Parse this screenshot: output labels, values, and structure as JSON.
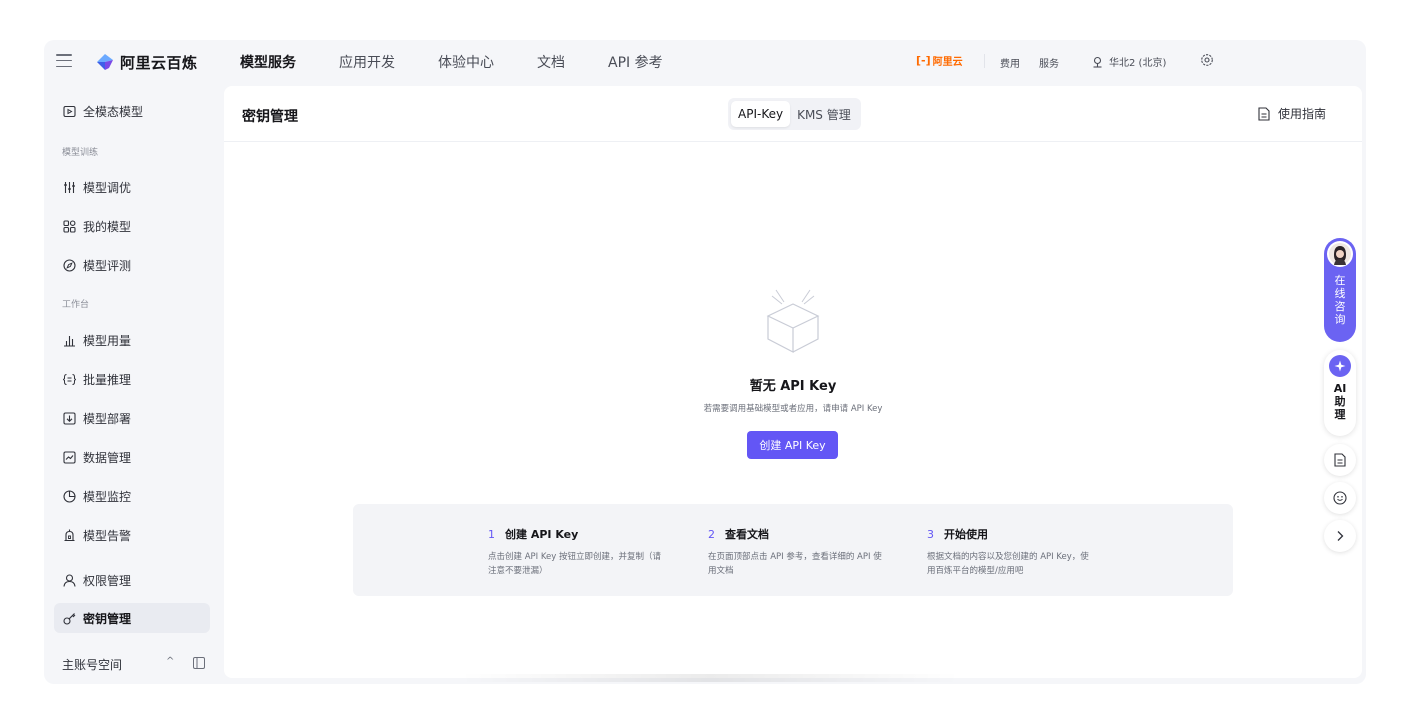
{
  "brand": {
    "name": "阿里云百炼"
  },
  "nav": {
    "items": [
      "模型服务",
      "应用开发",
      "体验中心",
      "文档",
      "API 参考"
    ],
    "active": 0
  },
  "topbar": {
    "aliyun_logo": "阿里云",
    "cost": "费用",
    "service": "服务",
    "region": "华北2 (北京)"
  },
  "sidebar": {
    "items": [
      {
        "label": "全模态模型",
        "icon": "multimodal-icon"
      },
      {
        "label": "模型调优",
        "icon": "tune-icon"
      },
      {
        "label": "我的模型",
        "icon": "my-models-icon"
      },
      {
        "label": "模型评测",
        "icon": "compass-icon"
      },
      {
        "label": "模型用量",
        "icon": "bar-chart-icon"
      },
      {
        "label": "批量推理",
        "icon": "batch-icon"
      },
      {
        "label": "模型部署",
        "icon": "deploy-icon"
      },
      {
        "label": "数据管理",
        "icon": "data-icon"
      },
      {
        "label": "模型监控",
        "icon": "monitor-icon"
      },
      {
        "label": "模型告警",
        "icon": "alarm-icon"
      },
      {
        "label": "权限管理",
        "icon": "user-icon"
      },
      {
        "label": "密钥管理",
        "icon": "key-icon"
      }
    ],
    "groups": [
      "模型训练",
      "工作台"
    ],
    "footer": "主账号空间"
  },
  "page": {
    "title": "密钥管理",
    "tabs": [
      "API-Key",
      "KMS 管理"
    ],
    "active_tab": 0,
    "guide": "使用指南"
  },
  "empty": {
    "title": "暂无 API Key",
    "desc": "若需要调用基础模型或者应用，请申请 API Key",
    "button": "创建 API Key"
  },
  "steps": [
    {
      "num": "1",
      "title": "创建 API Key",
      "desc": "点击创建 API Key 按钮立即创建，并复制（请注意不要泄漏）"
    },
    {
      "num": "2",
      "title": "查看文档",
      "desc": "在页面顶部点击 API 参考，查看详细的 API 使用文档"
    },
    {
      "num": "3",
      "title": "开始使用",
      "desc": "根据文档的内容以及您创建的 API Key，使用百炼平台的模型/应用吧"
    }
  ],
  "float": {
    "consult": "在线咨询",
    "ai": "AI助理"
  },
  "colors": {
    "accent": "#6356f5",
    "aliyun": "#ff6a00"
  }
}
